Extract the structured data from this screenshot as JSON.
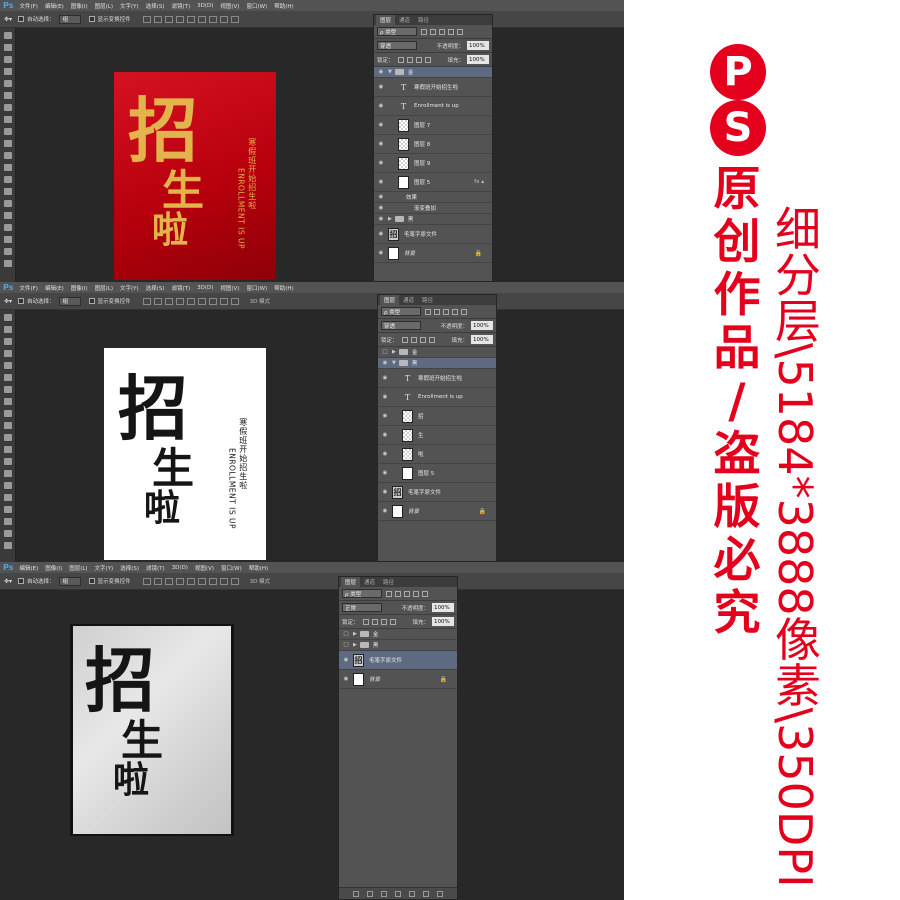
{
  "menu": {
    "logo": "Ps",
    "items": [
      "文件(F)",
      "编辑(E)",
      "图像(I)",
      "图层(L)",
      "文字(Y)",
      "选择(S)",
      "滤镜(T)",
      "3D(D)",
      "视图(V)",
      "窗口(W)",
      "帮助(H)"
    ]
  },
  "options": {
    "autoselect_label": "自动选择：",
    "autoselect_value": "组",
    "transform_label": "显示变换控件",
    "mode3d": "3D 模式"
  },
  "panel": {
    "tabs": [
      "图层",
      "通道",
      "路径"
    ],
    "filter_kind": "ρ 类型",
    "lock_label": "锁定：",
    "opacity_label": "不透明度：",
    "opacity_value": "100%",
    "fill_label": "填充：",
    "fill_value": "100%"
  },
  "artwork": {
    "char_zhao": "招",
    "char_sheng": "生",
    "char_la": "啦",
    "subtitle_cn": "寒假班开始招生啦",
    "subtitle_en": "ENROLLMENT IS UP"
  },
  "shot1": {
    "blend": "穿透",
    "layers": [
      {
        "name": "金",
        "kind": "group-open"
      },
      {
        "name": "寒假班开始招生啦",
        "kind": "text"
      },
      {
        "name": "Enrollment is up",
        "kind": "text"
      },
      {
        "name": "图层 7",
        "kind": "pixel"
      },
      {
        "name": "图层 8",
        "kind": "pixel"
      },
      {
        "name": "图层 9",
        "kind": "pixel"
      },
      {
        "name": "图层 5",
        "kind": "pixel-fx"
      },
      {
        "name": "效果",
        "kind": "effect"
      },
      {
        "name": "渐变叠加",
        "kind": "effect-item"
      },
      {
        "name": "黑",
        "kind": "group-closed"
      },
      {
        "name": "毛笔字原文件",
        "kind": "ink"
      },
      {
        "name": "背景",
        "kind": "background"
      }
    ]
  },
  "shot2": {
    "blend": "穿透",
    "layers": [
      {
        "name": "金",
        "kind": "group-closed"
      },
      {
        "name": "黑",
        "kind": "group-open-selected"
      },
      {
        "name": "寒假班开始招生啦",
        "kind": "text"
      },
      {
        "name": "Enrollment is up",
        "kind": "text"
      },
      {
        "name": "招",
        "kind": "pixel"
      },
      {
        "name": "生",
        "kind": "pixel"
      },
      {
        "name": "啦",
        "kind": "pixel"
      },
      {
        "name": "图层 5",
        "kind": "pixel"
      },
      {
        "name": "毛笔字原文件",
        "kind": "ink"
      },
      {
        "name": "背景",
        "kind": "background"
      }
    ]
  },
  "shot3": {
    "blend": "正常",
    "layers": [
      {
        "name": "金",
        "kind": "group-closed"
      },
      {
        "name": "黑",
        "kind": "group-closed"
      },
      {
        "name": "毛笔字原文件",
        "kind": "ink-selected"
      },
      {
        "name": "背景",
        "kind": "background"
      }
    ]
  },
  "side": {
    "badge_p": "P",
    "badge_s": "S",
    "red_chars": [
      "原",
      "创",
      "作",
      "品",
      "/",
      "盗",
      "版",
      "必",
      "究"
    ],
    "spec": "细分层\\5184*3888像素\\350DPI"
  },
  "colors": {
    "brand_red": "#e4001d",
    "gold": "#e3b44c",
    "ps_dark": "#282828",
    "panel": "#535353"
  }
}
